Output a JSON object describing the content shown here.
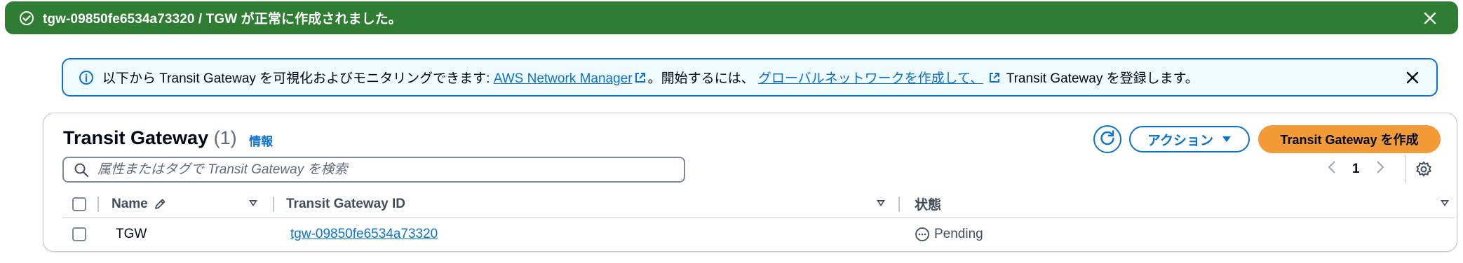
{
  "flash": {
    "message": "tgw-09850fe6534a73320 / TGW が正常に作成されました。",
    "icon": "check-circle-icon",
    "close_icon": "close-icon",
    "color": "#2e7d32"
  },
  "info": {
    "icon": "info-circle-icon",
    "text_before": "以下から Transit Gateway を可視化およびモニタリングできます: ",
    "link1": "AWS Network Manager",
    "text_middle": "。開始するには、 ",
    "link2": "グローバルネットワークを作成して、",
    "text_after": " Transit Gateway を登録します。",
    "external_icon": "external-link-icon",
    "close_icon": "close-icon"
  },
  "panel": {
    "title": "Transit Gateway",
    "count": "(1)",
    "info_link": "情報",
    "refresh_icon": "refresh-icon",
    "actions_label": "アクション",
    "create_label": "Transit Gateway を作成",
    "search_placeholder": "属性またはタグで Transit Gateway を検索",
    "page": "1",
    "accent": "#0972d3",
    "primary": "#f29a35"
  },
  "table": {
    "columns": [
      {
        "label": "Name",
        "icon": "edit-pencil-icon"
      },
      {
        "label": "Transit Gateway ID"
      },
      {
        "label": "状態"
      }
    ],
    "rows": [
      {
        "name": "TGW",
        "id": "tgw-09850fe6534a73320",
        "state": "Pending",
        "state_icon": "pending-icon"
      }
    ]
  }
}
